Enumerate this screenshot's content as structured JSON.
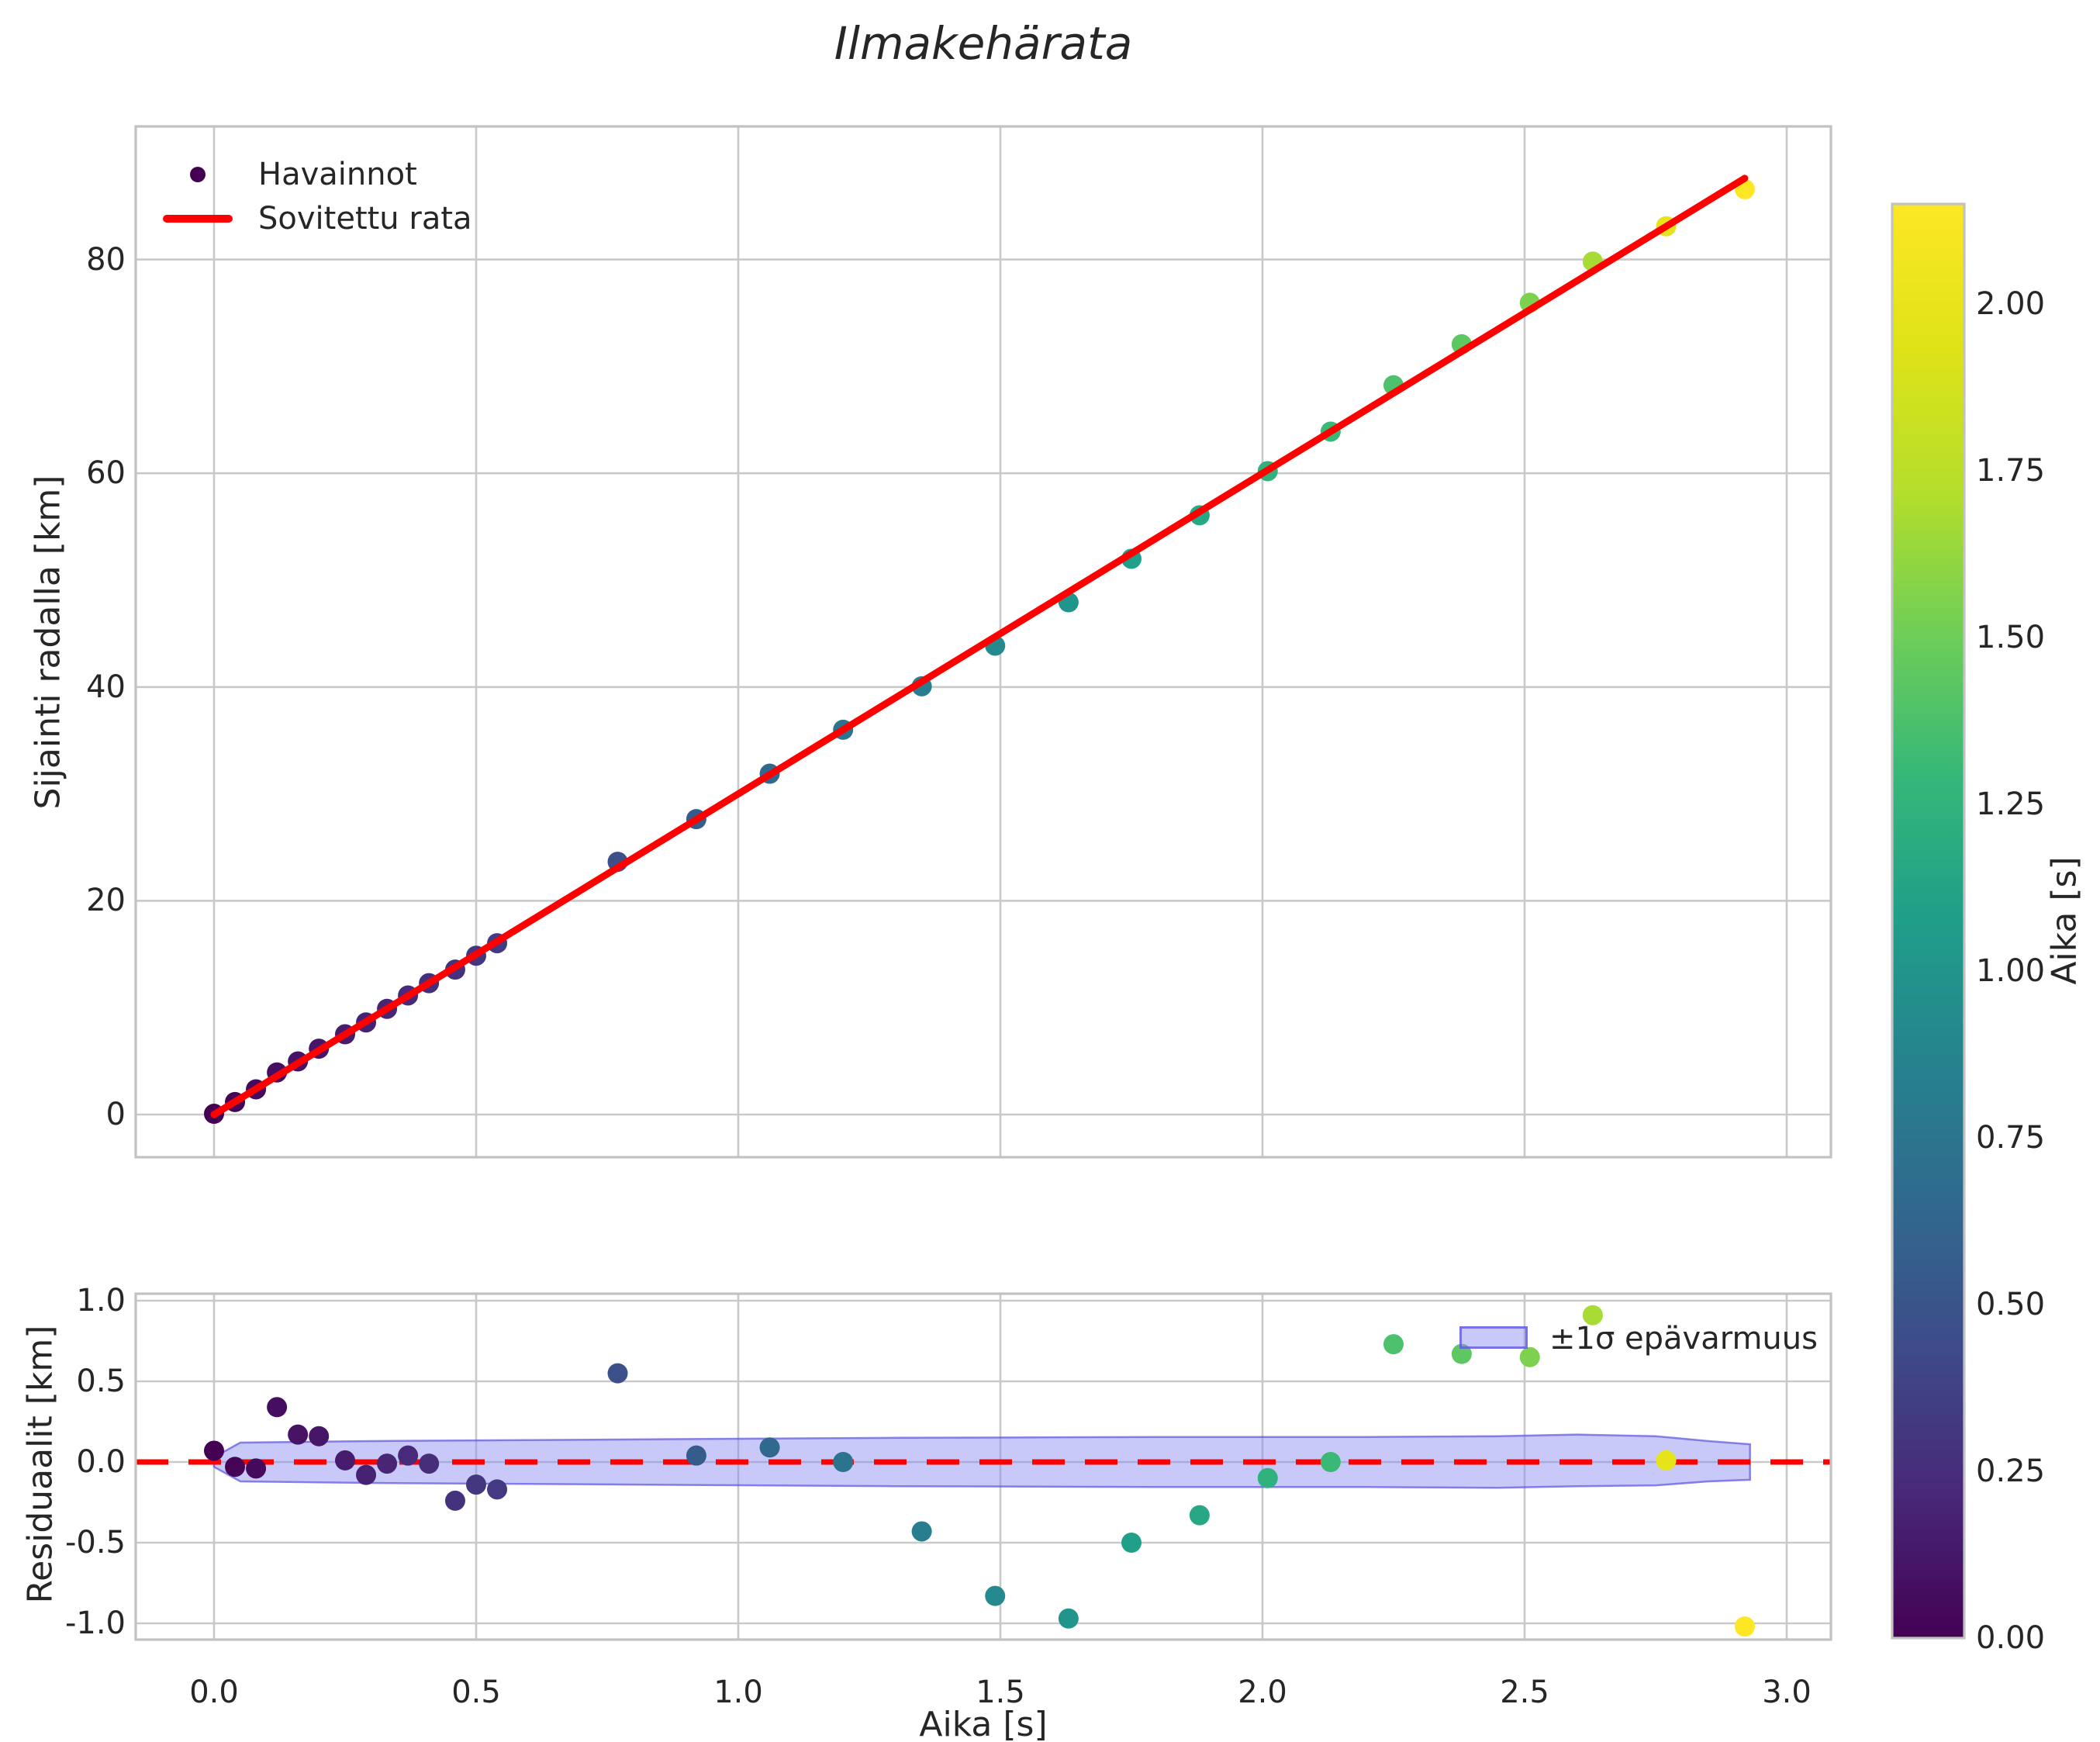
{
  "title": "Ilmakehärata",
  "top_plot": {
    "ylabel": "Sijainti radalla [km]",
    "ytick_labels": [
      "0",
      "20",
      "40",
      "60",
      "80"
    ],
    "ytick_values": [
      0,
      20,
      40,
      60,
      80
    ],
    "legend": {
      "observations": "Havainnot",
      "fit": "Sovitettu rata"
    }
  },
  "residual_plot": {
    "ylabel": "Residuaalit [km]",
    "xlabel": "Aika [s]",
    "xtick_labels": [
      "0.0",
      "0.5",
      "1.0",
      "1.5",
      "2.0",
      "2.5",
      "3.0"
    ],
    "xtick_values": [
      0,
      0.5,
      1.0,
      1.5,
      2.0,
      2.5,
      3.0
    ],
    "ytick_labels": [
      "1.0",
      "0.5",
      "0.0",
      "-0.5",
      "-1.0"
    ],
    "ytick_values": [
      1.0,
      0.5,
      0.0,
      -0.5,
      -1.0
    ],
    "legend_label": "±1σ epävarmuus"
  },
  "colorbar": {
    "label": "Aika [s]",
    "tick_labels": [
      "0.00",
      "0.25",
      "0.50",
      "0.75",
      "1.00",
      "1.25",
      "1.50",
      "1.75",
      "2.00"
    ],
    "tick_values": [
      0,
      0.25,
      0.5,
      0.75,
      1.0,
      1.25,
      1.5,
      1.75,
      2.0
    ],
    "vmin": 0.0,
    "vmax": 2.15
  },
  "colors": {
    "fit_line": "#ff0000",
    "zero_line": "#ff0000",
    "band_fill": "#8888f2",
    "band_edge": "#5d53e0",
    "grid": "#c9c9c9",
    "spine": "#c2c2c2",
    "text": "#262626",
    "legend_marker": "#440154",
    "viridis": [
      "#440154",
      "#482878",
      "#3e4a89",
      "#31688e",
      "#26828e",
      "#1f9e89",
      "#35b779",
      "#6ece58",
      "#b5de2b",
      "#dfe318",
      "#fde725"
    ]
  },
  "chart_data": {
    "type": "scatter",
    "title": "Ilmakehärata",
    "xlabel": "Aika [s]",
    "top_ylabel": "Sijainti radalla [km]",
    "residual_ylabel": "Residuaalit [km]",
    "xlim": [
      -0.15,
      3.08
    ],
    "top_ylim": [
      -4.0,
      92.5
    ],
    "residual_ylim": [
      -1.08,
      1.05
    ],
    "grid": true,
    "points": {
      "t_s": [
        0.0,
        0.04,
        0.08,
        0.12,
        0.16,
        0.2,
        0.25,
        0.29,
        0.33,
        0.37,
        0.41,
        0.46,
        0.5,
        0.54,
        0.77,
        0.92,
        1.06,
        1.2,
        1.35,
        1.49,
        1.63,
        1.75,
        1.88,
        2.01,
        2.13,
        2.25,
        2.38,
        2.51,
        2.63,
        2.77,
        2.92
      ],
      "position_km": [
        0.07,
        1.17,
        2.36,
        3.94,
        4.97,
        6.16,
        7.51,
        8.62,
        9.89,
        11.14,
        12.29,
        13.56,
        14.86,
        16.03,
        23.65,
        27.64,
        31.89,
        36.0,
        40.07,
        43.87,
        47.93,
        52.0,
        56.07,
        60.2,
        63.9,
        68.23,
        72.07,
        75.95,
        79.81,
        83.11,
        86.58
      ],
      "residual_km": [
        0.07,
        -0.03,
        -0.04,
        0.34,
        0.17,
        0.16,
        0.01,
        -0.08,
        -0.01,
        0.04,
        -0.01,
        -0.24,
        -0.14,
        -0.17,
        0.55,
        0.04,
        0.09,
        0.0,
        -0.43,
        -0.83,
        -0.97,
        -0.5,
        -0.33,
        -0.1,
        0.0,
        0.73,
        0.67,
        0.65,
        0.91,
        0.01,
        -1.02
      ],
      "color_value_s": [
        0.0,
        0.02,
        0.05,
        0.07,
        0.1,
        0.12,
        0.15,
        0.18,
        0.2,
        0.23,
        0.25,
        0.28,
        0.31,
        0.33,
        0.47,
        0.56,
        0.65,
        0.74,
        0.83,
        0.92,
        1.0,
        1.08,
        1.15,
        1.24,
        1.31,
        1.38,
        1.44,
        1.55,
        1.68,
        1.98,
        2.15
      ]
    },
    "fit_line": {
      "label": "Sovitettu rata",
      "slope_km_per_s": 30.0,
      "intercept_km": 0.0,
      "t_start": 0.0,
      "t_end": 2.92
    },
    "uncertainty_band": {
      "label": "±1σ epävarmuus",
      "t_s": [
        0.0,
        0.05,
        0.3,
        0.8,
        1.3,
        1.8,
        2.2,
        2.45,
        2.6,
        2.75,
        2.85,
        2.93
      ],
      "upper": [
        0.03,
        0.12,
        0.13,
        0.14,
        0.15,
        0.155,
        0.155,
        0.16,
        0.17,
        0.16,
        0.13,
        0.11
      ],
      "lower": [
        -0.03,
        -0.12,
        -0.13,
        -0.14,
        -0.15,
        -0.155,
        -0.155,
        -0.16,
        -0.15,
        -0.145,
        -0.12,
        -0.11
      ]
    }
  }
}
